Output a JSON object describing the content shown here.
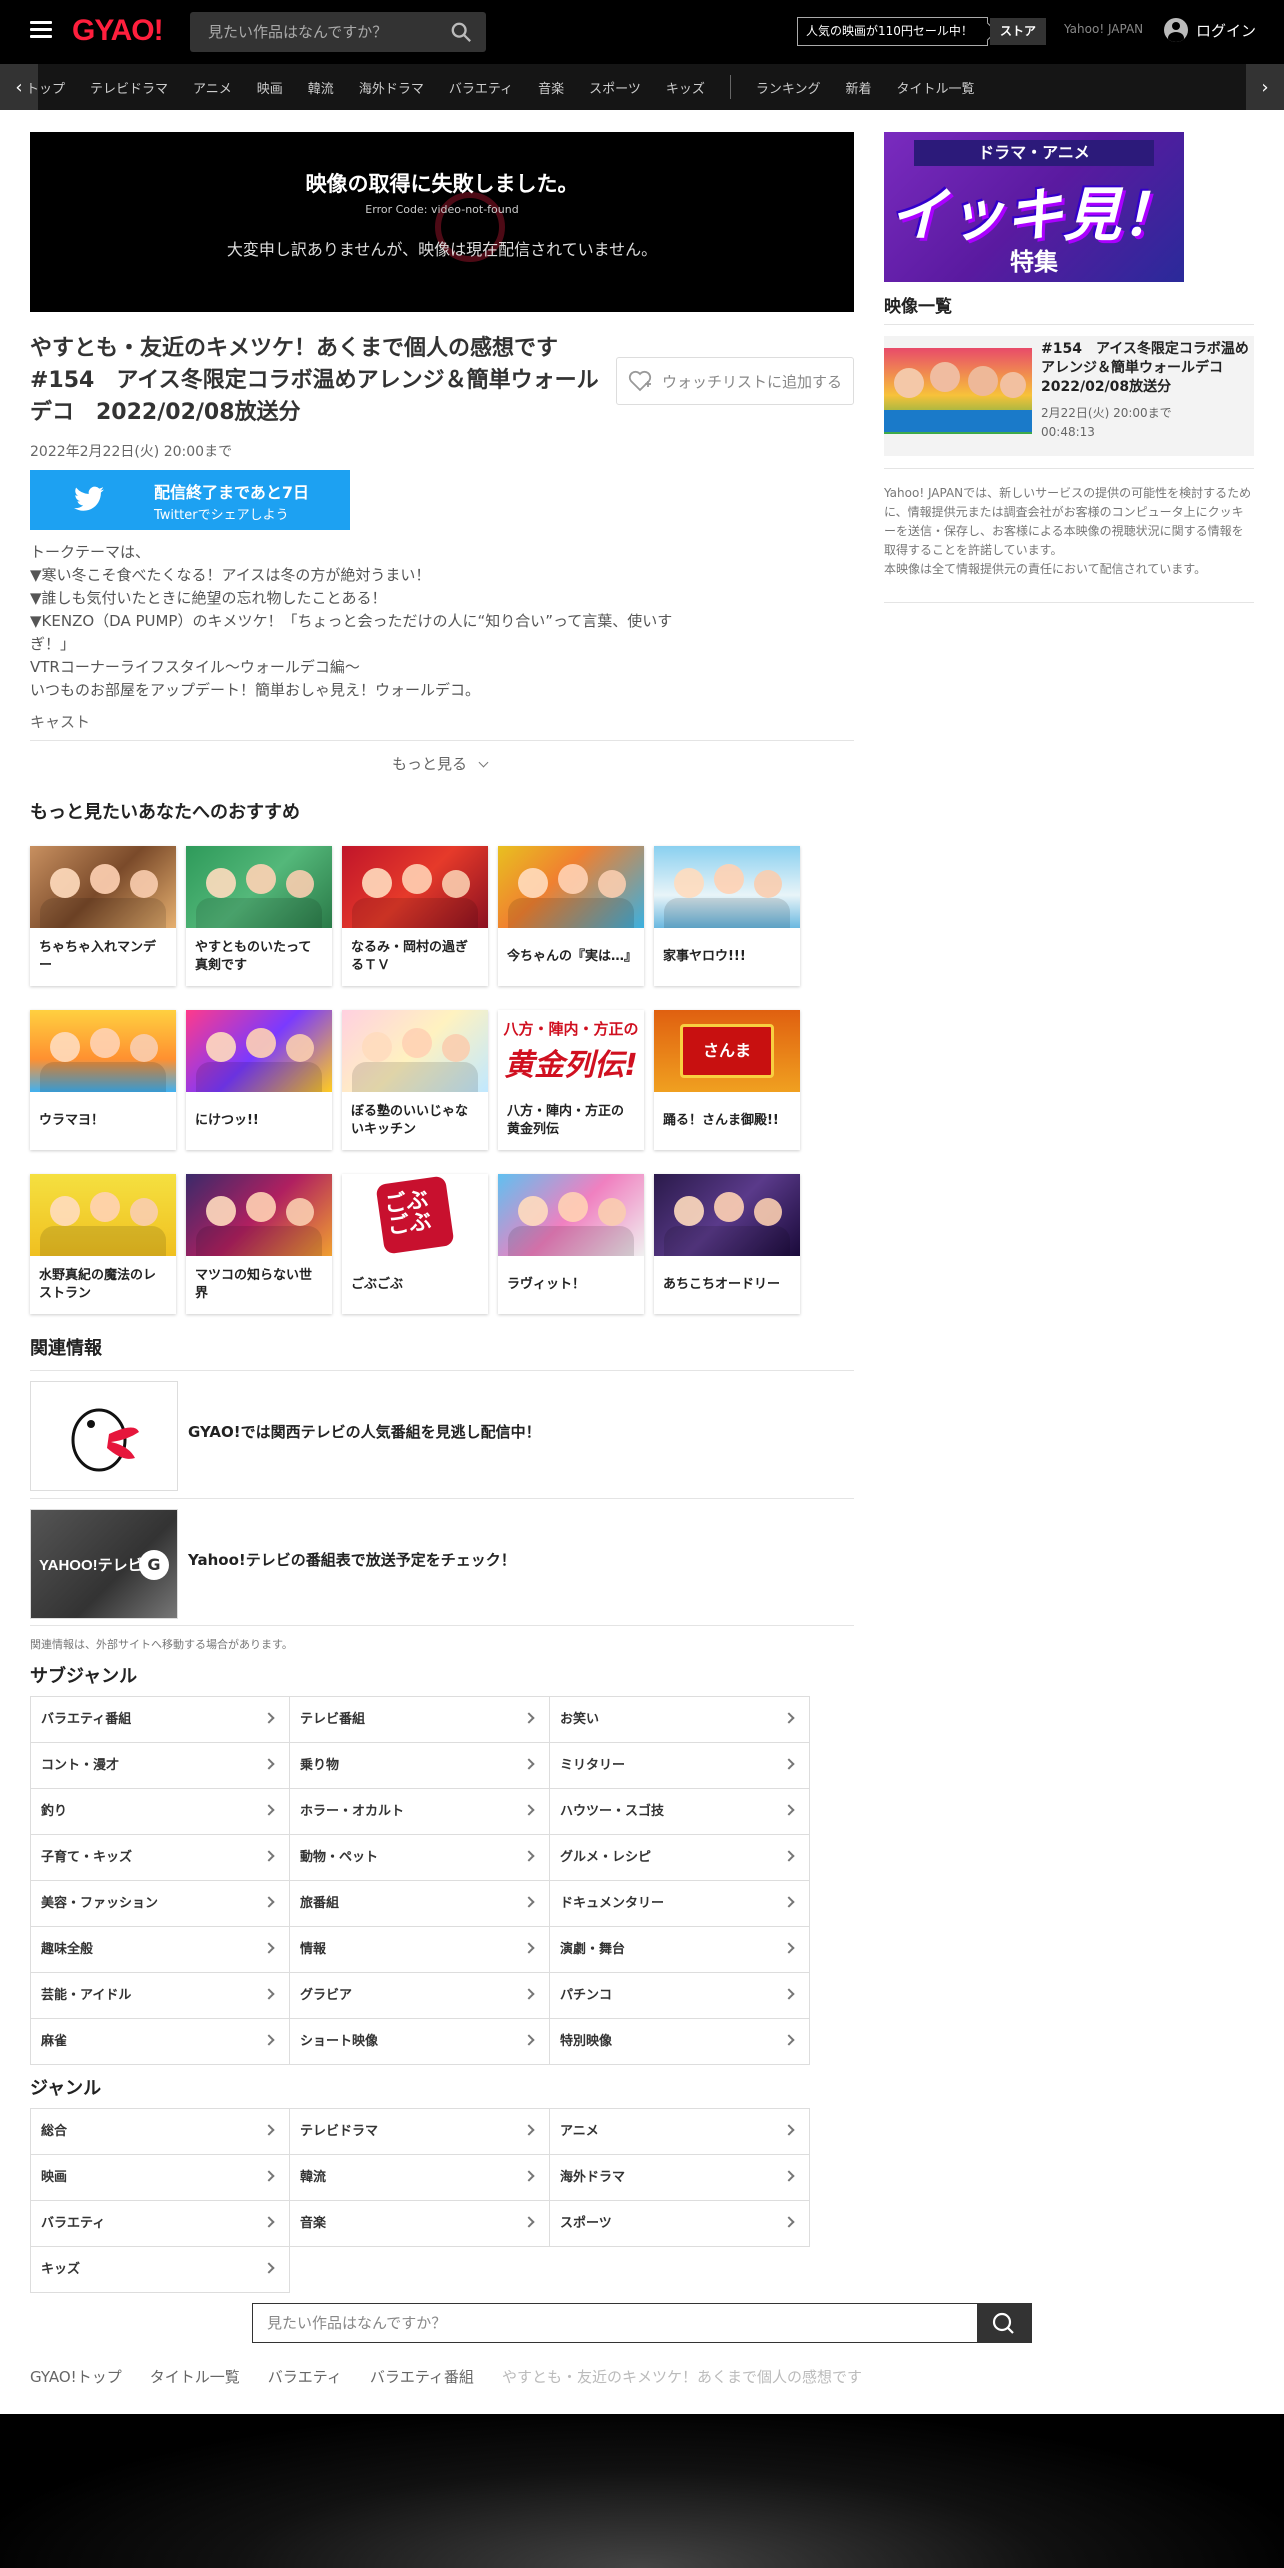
{
  "header": {
    "logo": "GYAO!",
    "search_placeholder": "見たい作品はなんですか？",
    "sale_text": "人気の映画が110円セール中！",
    "store_label": "ストア",
    "yahoo_link": "Yahoo! JAPAN",
    "login_label": "ログイン"
  },
  "nav": {
    "items_a": [
      "トップ",
      "テレビドラマ",
      "アニメ",
      "映画",
      "韓流",
      "海外ドラマ",
      "バラエティ",
      "音楽",
      "スポーツ",
      "キッズ"
    ],
    "items_b": [
      "ランキング",
      "新着",
      "タイトル一覧"
    ]
  },
  "player": {
    "error_title": "映像の取得に失敗しました。",
    "error_code": "Error Code: video-not-found",
    "error_message": "大変申し訳ありませんが、映像は現在配信されていません。"
  },
  "episode": {
    "title": "やすとも・友近のキメツケ！あくまで個人の感想です　#154　アイス冬限定コラボ温めアレンジ＆簡単ウォールデコ　2022/02/08放送分",
    "watchlist_label": "ウォッチリストに追加する",
    "date_line": "2022年2月22日(火) 20:00まで",
    "twitter_main": "配信終了まであと7日",
    "twitter_sub": "Twitterでシェアしよう",
    "description": [
      "トークテーマは、",
      "▼寒い冬こそ食べたくなる！アイスは冬の方が絶対うまい！",
      "▼誰しも気付いたときに絶望の忘れ物したことある！",
      "▼KENZO（DA PUMP）のキメツケ！「ちょっと会っただけの人に“知り合い”って言葉、使いすぎ！」",
      "VTRコーナーライフスタイル～ウォールデコ編～",
      "いつものお部屋をアップデート！簡単おしゃ見え！ウォールデコ。"
    ],
    "cast_label": "キャスト",
    "more_label": "もっと見る"
  },
  "recommend": {
    "title": "もっと見たいあなたへのおすすめ",
    "items": [
      {
        "label": "ちゃちゃ入れマンデー"
      },
      {
        "label": "やすとものいたって真剣です"
      },
      {
        "label": "なるみ・岡村の過ぎるＴＶ"
      },
      {
        "label": "今ちゃんの『実は…』"
      },
      {
        "label": "家事ヤロウ!!!"
      },
      {
        "label": "ウラマヨ！"
      },
      {
        "label": "にけつッ!!"
      },
      {
        "label": "ぼる塾のいいじゃないキッチン"
      },
      {
        "label": "八方・陣内・方正の黄金列伝"
      },
      {
        "label": "踊る！さんま御殿!!"
      },
      {
        "label": "水野真紀の魔法のレストラン"
      },
      {
        "label": "マツコの知らない世界"
      },
      {
        "label": "ごぶごぶ"
      },
      {
        "label": "ラヴィット！"
      },
      {
        "label": "あちこちオードリー"
      }
    ]
  },
  "related": {
    "title": "関連情報",
    "items": [
      {
        "label": "GYAO!では関西テレビの人気番組を見逃し配信中！"
      },
      {
        "label": "Yahoo!テレビの番組表で放送予定をチェック！"
      }
    ],
    "note": "関連情報は、外部サイトへ移動する場合があります。"
  },
  "subgenre": {
    "title": "サブジャンル",
    "items": [
      "バラエティ番組",
      "テレビ番組",
      "お笑い",
      "コント・漫才",
      "乗り物",
      "ミリタリー",
      "釣り",
      "ホラー・オカルト",
      "ハウツー・スゴ技",
      "子育て・キッズ",
      "動物・ペット",
      "グルメ・レシピ",
      "美容・ファッション",
      "旅番組",
      "ドキュメンタリー",
      "趣味全般",
      "情報",
      "演劇・舞台",
      "芸能・アイドル",
      "グラビア",
      "パチンコ",
      "麻雀",
      "ショート映像",
      "特別映像"
    ]
  },
  "genre": {
    "title": "ジャンル",
    "items": [
      "総合",
      "テレビドラマ",
      "アニメ",
      "映画",
      "韓流",
      "海外ドラマ",
      "バラエティ",
      "音楽",
      "スポーツ",
      "キッズ"
    ]
  },
  "bottom_search": {
    "placeholder": "見たい作品はなんですか？"
  },
  "breadcrumbs": [
    "GYAO!トップ",
    "タイトル一覧",
    "バラエティ",
    "バラエティ番組",
    "やすとも・友近のキメツケ！あくまで個人の感想です"
  ],
  "sidebar": {
    "banner_top": "ドラマ・アニメ",
    "banner_main": "イッキ見！",
    "banner_sub": "特集",
    "video_list_title": "映像一覧",
    "video_item": {
      "title": "#154　アイス冬限定コラボ温めアレンジ＆簡単ウォールデコ　2022/02/08放送分",
      "date": "2月22日(火) 20:00まで",
      "duration": "00:48:13"
    },
    "note": "Yahoo! JAPANでは、新しいサービスの提供の可能性を検討するために、情報提供元または調査会社がお客様のコンピュータ上にクッキーを送信・保存し、お客様による本映像の視聴状況に関する情報を取得することを許諾しています。\n本映像は全て情報提供元の責任において配信されています。"
  },
  "colors": {
    "brand": "#ff1f3d",
    "twitter": "#1da1f2"
  }
}
